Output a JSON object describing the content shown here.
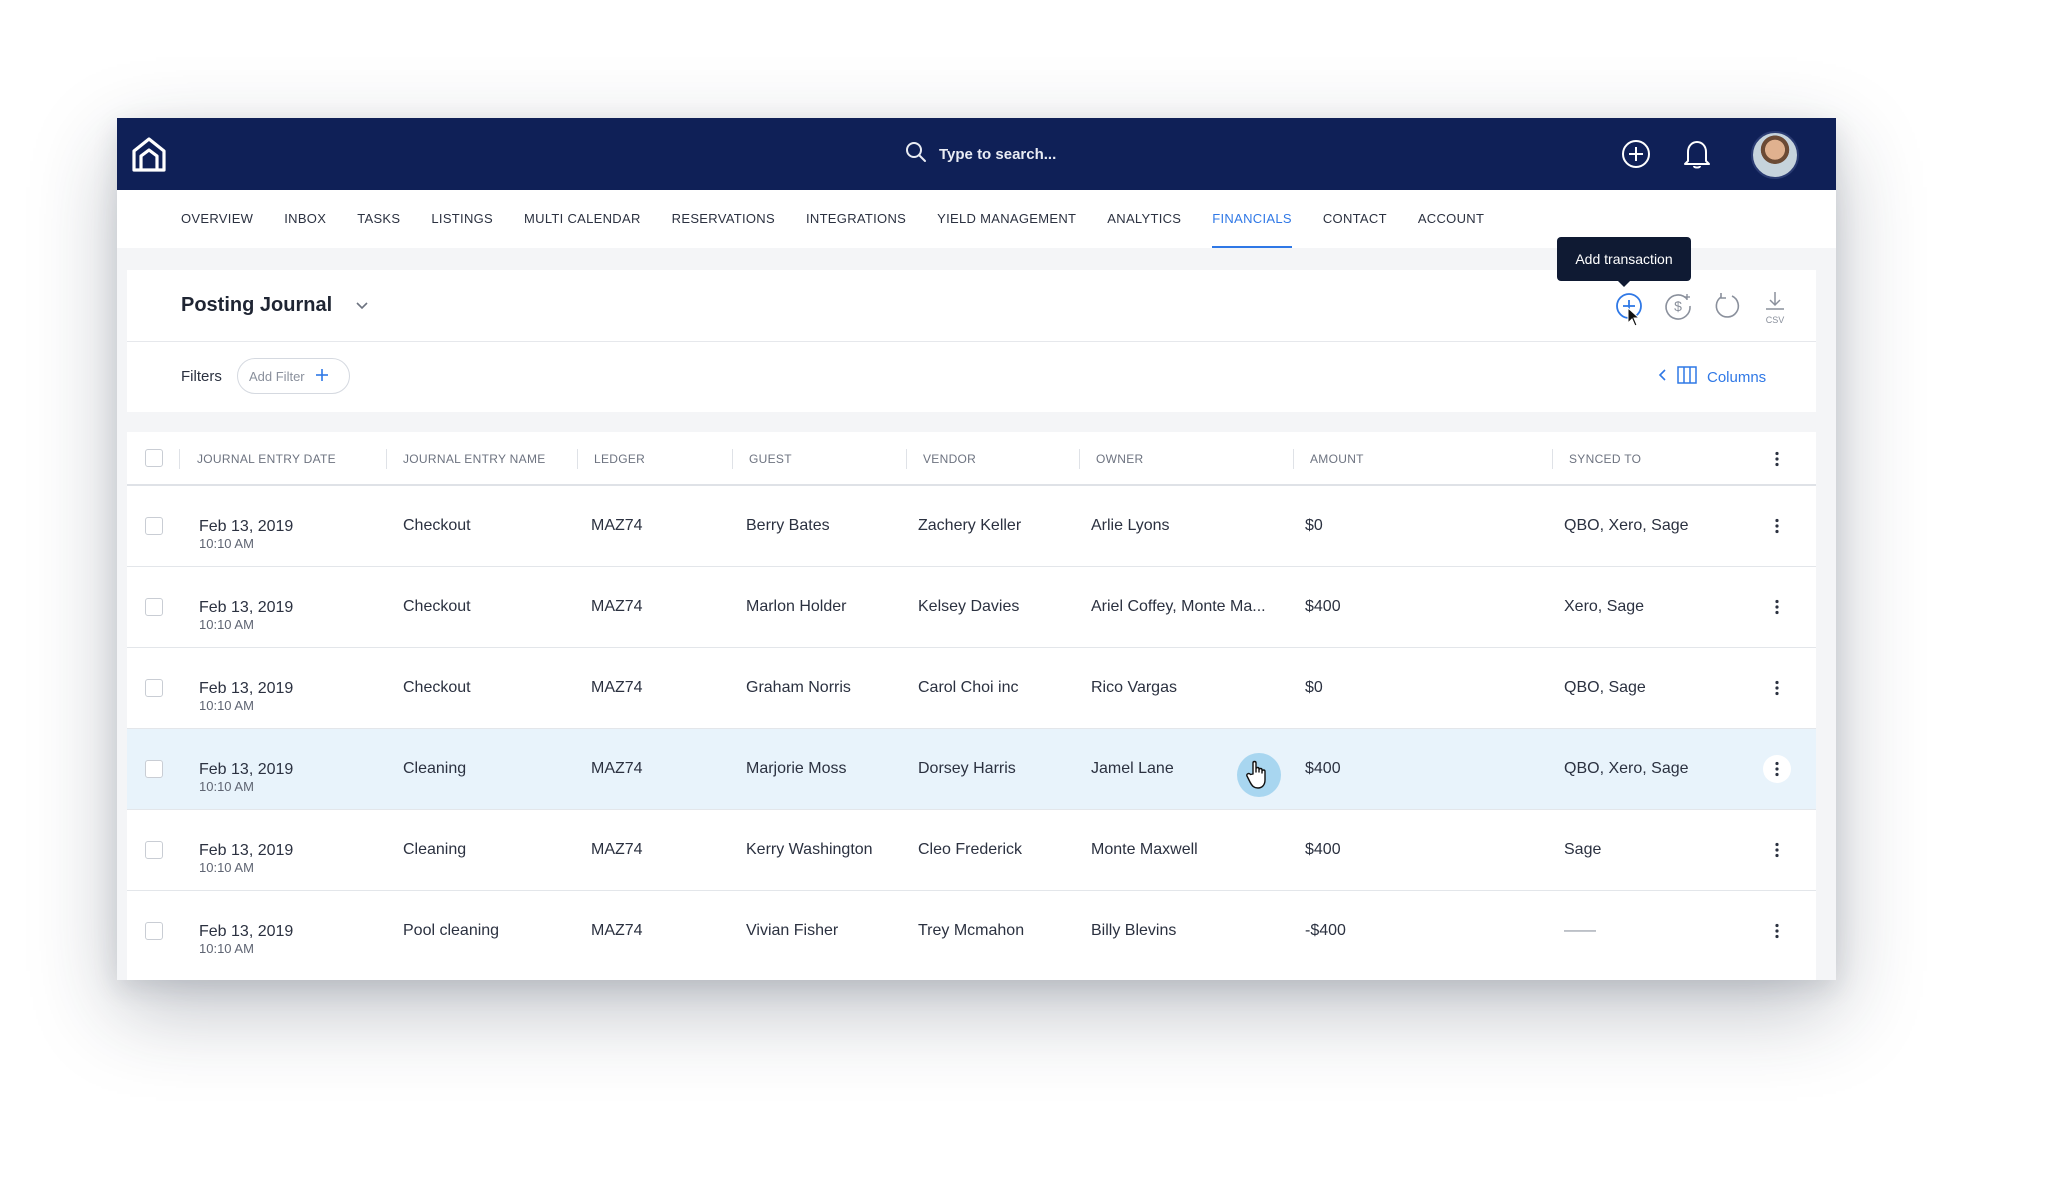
{
  "search": {
    "placeholder": "Type to search..."
  },
  "nav": {
    "items": [
      {
        "label": "OVERVIEW",
        "name": "nav-overview"
      },
      {
        "label": "INBOX",
        "name": "nav-inbox"
      },
      {
        "label": "TASKS",
        "name": "nav-tasks"
      },
      {
        "label": "LISTINGS",
        "name": "nav-listings"
      },
      {
        "label": "MULTI CALENDAR",
        "name": "nav-multi-calendar"
      },
      {
        "label": "RESERVATIONS",
        "name": "nav-reservations"
      },
      {
        "label": "INTEGRATIONS",
        "name": "nav-integrations"
      },
      {
        "label": "YIELD MANAGEMENT",
        "name": "nav-yield-management"
      },
      {
        "label": "ANALYTICS",
        "name": "nav-analytics"
      },
      {
        "label": "FINANCIALS",
        "name": "nav-financials",
        "active": true
      },
      {
        "label": "CONTACT",
        "name": "nav-contact"
      },
      {
        "label": "ACCOUNT",
        "name": "nav-account"
      }
    ]
  },
  "page": {
    "title": "Posting Journal",
    "tooltip": "Add transaction",
    "csv_label": "CSV"
  },
  "filters": {
    "label": "Filters",
    "add_filter": "Add Filter",
    "columns": "Columns"
  },
  "table": {
    "headers": [
      "JOURNAL ENTRY DATE",
      "JOURNAL ENTRY NAME",
      "LEDGER",
      "GUEST",
      "VENDOR",
      "OWNER",
      "AMOUNT",
      "SYNCED TO"
    ],
    "rows": [
      {
        "date": "Feb 13, 2019",
        "time": "10:10 AM",
        "name": "Checkout",
        "ledger": "MAZ74",
        "guest": "Berry Bates",
        "vendor": "Zachery Keller",
        "owner": "Arlie Lyons",
        "amount": "$0",
        "synced": "QBO, Xero, Sage"
      },
      {
        "date": "Feb 13, 2019",
        "time": "10:10 AM",
        "name": "Checkout",
        "ledger": "MAZ74",
        "guest": "Marlon Holder",
        "vendor": "Kelsey Davies",
        "owner": "Ariel Coffey, Monte Ma...",
        "amount": "$400",
        "synced": "Xero, Sage"
      },
      {
        "date": "Feb 13, 2019",
        "time": "10:10 AM",
        "name": "Checkout",
        "ledger": "MAZ74",
        "guest": "Graham Norris",
        "vendor": "Carol Choi inc",
        "owner": "Rico Vargas",
        "amount": "$0",
        "synced": "QBO, Sage"
      },
      {
        "date": "Feb 13, 2019",
        "time": "10:10 AM",
        "name": "Cleaning",
        "ledger": "MAZ74",
        "guest": "Marjorie Moss",
        "vendor": "Dorsey Harris",
        "owner": "Jamel Lane",
        "amount": "$400",
        "synced": "QBO, Xero, Sage",
        "highlighted": true
      },
      {
        "date": "Feb 13, 2019",
        "time": "10:10 AM",
        "name": "Cleaning",
        "ledger": "MAZ74",
        "guest": "Kerry Washington",
        "vendor": "Cleo Frederick",
        "owner": "Monte Maxwell",
        "amount": "$400",
        "synced": "Sage"
      },
      {
        "date": "Feb 13, 2019",
        "time": "10:10 AM",
        "name": "Pool cleaning",
        "ledger": "MAZ74",
        "guest": "Vivian Fisher",
        "vendor": "Trey Mcmahon",
        "owner": "Billy Blevins",
        "amount": "-$400",
        "synced": "——"
      }
    ]
  },
  "colors": {
    "topbar": "#0f2057",
    "accent": "#2f78e6",
    "row_highlight": "#e8f3fb"
  }
}
